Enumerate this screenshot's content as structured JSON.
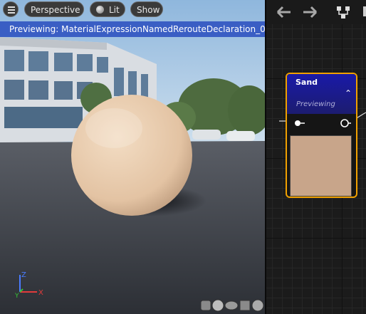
{
  "viewport": {
    "toolbar": {
      "menu_icon": "hamburger-menu-icon",
      "perspective_label": "Perspective",
      "lit_label": "Lit",
      "show_label": "Show"
    },
    "banner": "Previewing: MaterialExpressionNamedRerouteDeclaration_0",
    "axes": {
      "x": "X",
      "y": "Y",
      "z": "Z"
    },
    "preview_mode_icons": [
      "cylinder-icon",
      "sphere-icon",
      "plane-icon",
      "cube-icon",
      "teapot-icon"
    ]
  },
  "graph": {
    "toolbar_icons": [
      "back-arrow-icon",
      "forward-arrow-icon",
      "hierarchy-icon"
    ],
    "node": {
      "title": "Sand",
      "subtitle": "Previewing",
      "collapse_icon": "chevron-up-icon",
      "swatch_color": "#c8a58a",
      "accent_color": "#f0a000"
    }
  }
}
